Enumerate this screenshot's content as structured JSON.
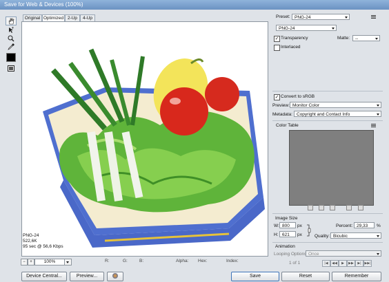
{
  "window": {
    "title": "Save for Web & Devices (100%)"
  },
  "tabs": [
    "Original",
    "Optimized",
    "2-Up",
    "4-Up"
  ],
  "image_info": {
    "format": "PNG-24",
    "size": "522,6K",
    "time": "95 sec @ 56,6 Kbps"
  },
  "status_bar": {
    "zoom": "100%",
    "r": "R:",
    "g": "G:",
    "b": "B:",
    "alpha": "Alpha:",
    "hex": "Hex:",
    "index": "Index:"
  },
  "buttons": {
    "device_central": "Device Central...",
    "preview": "Preview...",
    "save": "Save",
    "reset": "Reset",
    "remember": "Remember"
  },
  "settings": {
    "preset_label": "Preset:",
    "preset_value": "PNG-24",
    "format_value": "PNG-24",
    "transparency_label": "Transparency",
    "transparency_checked": true,
    "matte_label": "Matte:",
    "matte_value": "--",
    "interlaced_label": "Interlaced",
    "interlaced_checked": false,
    "convert_srgb_label": "Convert to sRGB",
    "convert_srgb_checked": true,
    "preview_label": "Preview:",
    "preview_value": "Monitor Color",
    "metadata_label": "Metadata:",
    "metadata_value": "Copyright and Contact Info"
  },
  "color_table": {
    "title": "Color Table",
    "fill_color": "#7f7f7f"
  },
  "image_size": {
    "title": "Image Size",
    "w_label": "W:",
    "w_value": "800",
    "w_unit": "px",
    "h_label": "H:",
    "h_value": "621",
    "h_unit": "px",
    "percent_label": "Percent:",
    "percent_value": "29,33",
    "percent_unit": "%",
    "quality_label": "Quality:",
    "quality_value": "Bicubic"
  },
  "animation": {
    "title": "Animation",
    "looping_label": "Looping Options:",
    "looping_value": "Once",
    "frame_counter": "1 of 1"
  },
  "icons": [
    "hand-icon",
    "slice-select-icon",
    "zoom-icon",
    "eyedropper-icon",
    "eyedropper-color-swatch",
    "toggle-slices-icon",
    "panel-menu-icon",
    "link-icon",
    "browser-icon"
  ]
}
